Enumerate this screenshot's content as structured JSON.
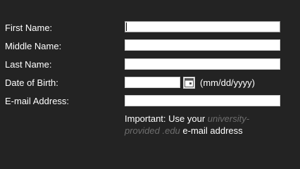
{
  "form": {
    "fields": [
      {
        "label": "First Name:",
        "value": "",
        "placeholder": ""
      },
      {
        "label": "Middle Name:",
        "value": "",
        "placeholder": ""
      },
      {
        "label": "Last Name:",
        "value": "",
        "placeholder": ""
      },
      {
        "label": "Date of Birth:",
        "value": "",
        "placeholder": ""
      },
      {
        "label": "E-mail Address:",
        "value": "",
        "placeholder": ""
      }
    ],
    "dob_format_hint": "(mm/dd/yyyy)",
    "calendar_icon": "calendar-icon",
    "note": {
      "prefix": "Important: Use your",
      "highlight": "university-provided .edu",
      "suffix": "e-mail address"
    }
  },
  "colors": {
    "background": "#232323",
    "text": "#ffffff",
    "muted_text": "#6e6e6e",
    "field_background": "#ffffff"
  }
}
